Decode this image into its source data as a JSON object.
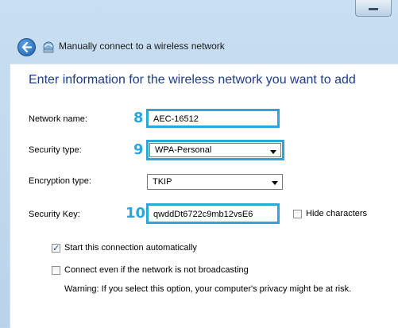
{
  "window": {
    "title": "Manually connect to a wireless network",
    "heading": "Enter information for the wireless network you want to add"
  },
  "form": {
    "network_name": {
      "label": "Network name:",
      "value": "AEC-16512",
      "step": "8"
    },
    "security_type": {
      "label": "Security type:",
      "value": "WPA-Personal",
      "step": "9"
    },
    "encryption_type": {
      "label": "Encryption type:",
      "value": "TKIP"
    },
    "security_key": {
      "label": "Security Key:",
      "value": "qwddDt6722c9mb12vsE6",
      "step": "10"
    },
    "hide_characters": {
      "label": "Hide characters",
      "checked": false
    }
  },
  "options": {
    "start_auto": {
      "label": "Start this connection automatically",
      "checked": true
    },
    "connect_even": {
      "label": "Connect even if the network is not broadcasting",
      "checked": false
    },
    "warning": "Warning: If you select this option, your computer's privacy might be at risk."
  },
  "colors": {
    "highlight": "#2aa6dc",
    "heading": "#1e3a8a"
  },
  "icons": {
    "back": "back-arrow-icon",
    "network": "wireless-network-icon",
    "minimize": "minimize-icon"
  }
}
